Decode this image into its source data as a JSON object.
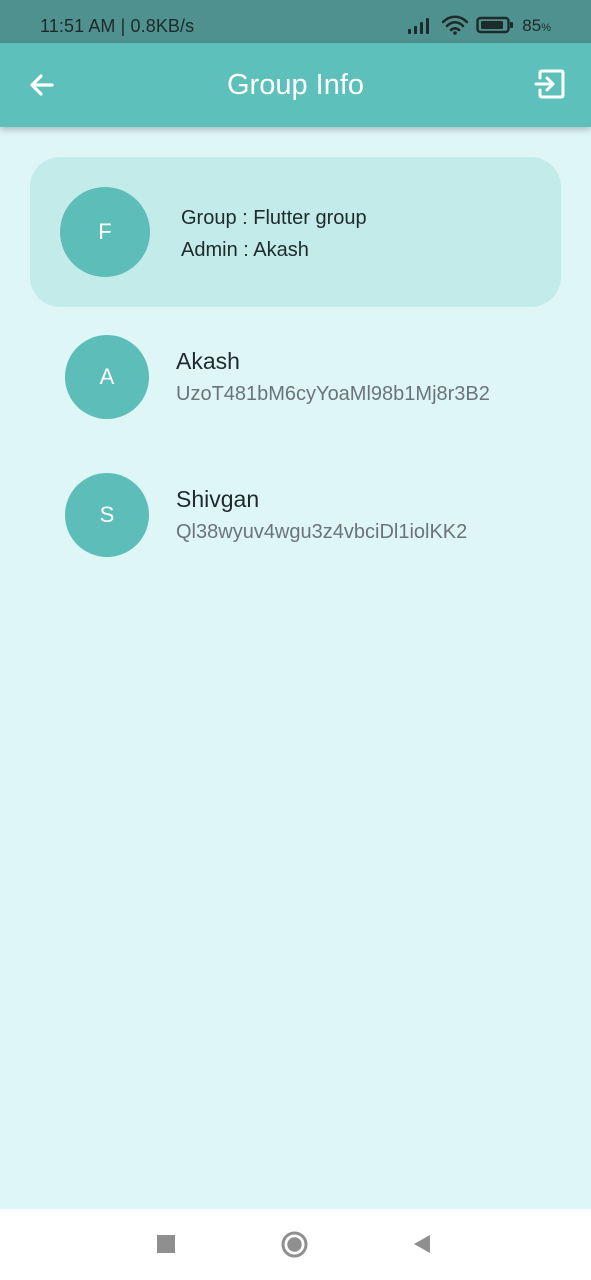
{
  "status_bar": {
    "time_speed": "11:51 AM | 0.8KB/s",
    "battery_value": "85",
    "battery_unit": "%",
    "icons": [
      "signal-icon",
      "wifi-icon",
      "battery-icon"
    ]
  },
  "app_bar": {
    "title": "Group Info",
    "icons": [
      "back-arrow-icon",
      "exit-icon"
    ]
  },
  "group": {
    "avatar_letter": "F",
    "group_line": "Group : Flutter group",
    "admin_line": "Admin : Akash"
  },
  "members": [
    {
      "avatar_letter": "A",
      "name": "Akash",
      "uid": "UzoT481bM6cyYoaMl98b1Mj8r3B2"
    },
    {
      "avatar_letter": "S",
      "name": "Shivgan",
      "uid": "Ql38wyuv4wgu3z4vbciDl1iolKK2"
    }
  ],
  "nav_bar": {
    "icons": [
      "recent-apps-icon",
      "home-icon",
      "back-icon"
    ]
  },
  "colors": {
    "status_bar": "#4f918e",
    "app_bar": "#5dc0bb",
    "background": "#dff6f6",
    "group_card": "#c2ebea",
    "avatar": "#5dbdb9",
    "title_text": "#ffffff"
  }
}
